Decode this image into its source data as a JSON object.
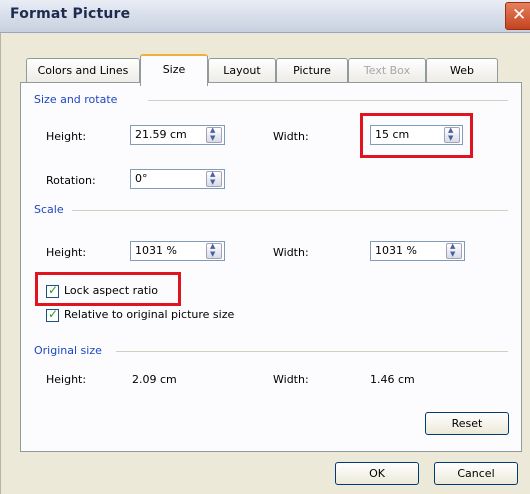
{
  "dialog": {
    "title": "Format Picture",
    "close_glyph": "✕"
  },
  "tabs": [
    "Colors and Lines",
    "Size",
    "Layout",
    "Picture",
    "Text Box",
    "Web"
  ],
  "size_rotate": {
    "heading": "Size and rotate",
    "height_label": "Height:",
    "height_value": "21.59 cm",
    "width_label": "Width:",
    "width_value": "15 cm",
    "rotation_label": "Rotation:",
    "rotation_value": "0°"
  },
  "scale": {
    "heading": "Scale",
    "height_label": "Height:",
    "height_value": "1031 %",
    "width_label": "Width:",
    "width_value": "1031 %",
    "lock_aspect_label": "Lock aspect ratio",
    "lock_aspect_checked": true,
    "relative_label": "Relative to original picture size",
    "relative_checked": true
  },
  "original": {
    "heading": "Original size",
    "height_label": "Height:",
    "height_value": "2.09 cm",
    "width_label": "Width:",
    "width_value": "1.46 cm"
  },
  "buttons": {
    "reset": "Reset",
    "ok": "OK",
    "cancel": "Cancel"
  },
  "colors": {
    "accent_blue": "#1e46c0",
    "highlight_red": "#e0141e",
    "dialog_bg": "#ece9d8",
    "check_green": "#21a121"
  }
}
